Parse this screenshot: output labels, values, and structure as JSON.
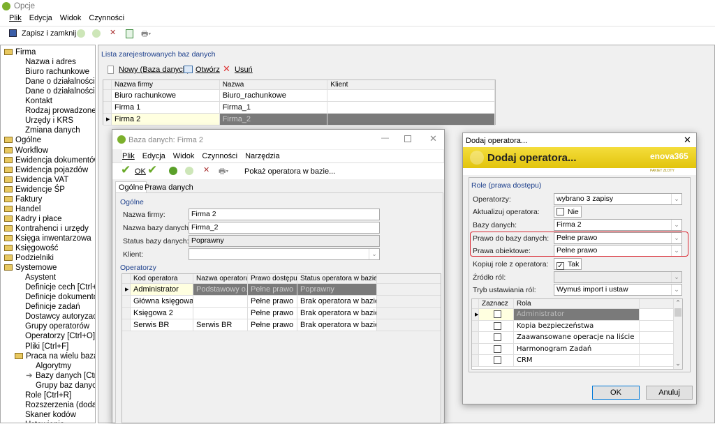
{
  "app": {
    "title": "Opcje",
    "menu": [
      "Plik",
      "Edycja",
      "Widok",
      "Czynności"
    ],
    "toolbar": {
      "save_close": "Zapisz i zamknij"
    }
  },
  "tree": {
    "items": [
      {
        "label": "Firma",
        "level": 0,
        "folder": true
      },
      {
        "label": "Nazwa i adres",
        "level": 2
      },
      {
        "label": "Biuro rachunkowe",
        "level": 2
      },
      {
        "label": "Dane o działalności",
        "level": 2
      },
      {
        "label": "Dane o działalności",
        "level": 2
      },
      {
        "label": "Kontakt",
        "level": 2
      },
      {
        "label": "Rodzaj prowadzonej",
        "level": 2
      },
      {
        "label": "Urzędy i KRS",
        "level": 2
      },
      {
        "label": "Zmiana danych",
        "level": 2
      },
      {
        "label": "Ogólne",
        "level": 0,
        "folder": true
      },
      {
        "label": "Workflow",
        "level": 0,
        "folder": true
      },
      {
        "label": "Ewidencja dokumentów",
        "level": 0,
        "folder": true
      },
      {
        "label": "Ewidencja pojazdów",
        "level": 0,
        "folder": true
      },
      {
        "label": "Ewidencja VAT",
        "level": 0,
        "folder": true
      },
      {
        "label": "Ewidencje ŚP",
        "level": 0,
        "folder": true
      },
      {
        "label": "Faktury",
        "level": 0,
        "folder": true
      },
      {
        "label": "Handel",
        "level": 0,
        "folder": true
      },
      {
        "label": "Kadry i płace",
        "level": 0,
        "folder": true
      },
      {
        "label": "Kontrahenci i urzędy",
        "level": 0,
        "folder": true
      },
      {
        "label": "Księga inwentarzowa",
        "level": 0,
        "folder": true
      },
      {
        "label": "Księgowość",
        "level": 0,
        "folder": true
      },
      {
        "label": "Podzielniki",
        "level": 0,
        "folder": true
      },
      {
        "label": "Systemowe",
        "level": 0,
        "folder": true
      },
      {
        "label": "Asystent",
        "level": 2
      },
      {
        "label": "Definicje cech [Ctrl+H",
        "level": 2
      },
      {
        "label": "Definicje dokumentów",
        "level": 2
      },
      {
        "label": "Definicje zadań",
        "level": 2
      },
      {
        "label": "Dostawcy autoryzacji",
        "level": 2
      },
      {
        "label": "Grupy operatorów",
        "level": 2
      },
      {
        "label": "Operatorzy [Ctrl+O]",
        "level": 2
      },
      {
        "label": "Pliki [Ctrl+F]",
        "level": 2
      },
      {
        "label": "Praca na wielu bazach",
        "level": 1,
        "folder": true
      },
      {
        "label": "Algorytmy",
        "level": 3
      },
      {
        "label": "Bazy danych [Ctrl+",
        "level": 3,
        "current": true
      },
      {
        "label": "Grupy baz danych",
        "level": 3
      },
      {
        "label": "Role [Ctrl+R]",
        "level": 2
      },
      {
        "label": "Rozszerzenia (dodat",
        "level": 2
      },
      {
        "label": "Skaner kodów",
        "level": 2
      },
      {
        "label": "Ustawienia",
        "level": 2
      }
    ]
  },
  "main": {
    "group_title": "Lista zarejestrowanych baz danych",
    "toolbar": {
      "new": "Nowy (Baza danych)",
      "open": "Otwórz",
      "delete": "Usuń"
    },
    "columns": [
      "Nazwa firmy",
      "Nazwa",
      "Klient"
    ],
    "rows": [
      [
        "Biuro rachunkowe",
        "Biuro_rachunkowe",
        ""
      ],
      [
        "Firma 1",
        "Firma_1",
        ""
      ],
      [
        "Firma 2",
        "Firma_2",
        ""
      ]
    ]
  },
  "db_dialog": {
    "title": "Baza danych: Firma 2",
    "menu": [
      "Plik",
      "Edycja",
      "Widok",
      "Czynności",
      "Narzędzia"
    ],
    "toolbar": {
      "ok": "OK",
      "show_operator": "Pokaż operatora w bazie..."
    },
    "tabs": [
      "Ogólne",
      "Prawa danych"
    ],
    "general_group": "Ogólne",
    "fields": [
      {
        "label": "Nazwa firmy:",
        "value": "Firma 2"
      },
      {
        "label": "Nazwa bazy danych:",
        "value": "Firma_2"
      },
      {
        "label": "Status bazy danych:",
        "value": "Poprawny"
      },
      {
        "label": "Klient:",
        "value": ""
      }
    ],
    "operators_group": "Operatorzy",
    "columns": [
      "Kod operatora",
      "Nazwa operatora",
      "Prawo dostępu",
      "Status operatora w bazie"
    ],
    "rows": [
      [
        "Administrator",
        "Podstawowy o...",
        "Pełne prawo",
        "Poprawny"
      ],
      [
        "Główna księgowa",
        "",
        "Pełne prawo",
        "Brak operatora w bazie"
      ],
      [
        "Księgowa 2",
        "",
        "Pełne prawo",
        "Brak operatora w bazie"
      ],
      [
        "Serwis BR",
        "Serwis BR",
        "Pełne prawo",
        "Brak operatora w bazie"
      ]
    ]
  },
  "add_dialog": {
    "title": "Dodaj operatora...",
    "banner": "Dodaj operatora...",
    "logo": "enova365",
    "package": "PAKIET ZŁOTY",
    "group": "Role (prawa dostępu)",
    "fields": [
      {
        "label": "Operatorzy:",
        "value": "wybrano 3 zapisy"
      },
      {
        "label": "Aktualizuj operatora:",
        "value": "Nie",
        "checked": false
      },
      {
        "label": "Bazy danych:",
        "value": "Firma 2"
      },
      {
        "label": "Prawo do bazy danych:",
        "value": "Pełne prawo"
      },
      {
        "label": "Prawa obiektowe:",
        "value": "Pełne prawo"
      },
      {
        "label": "Kopiuj role z operatora:",
        "value": "Tak",
        "checked": true
      },
      {
        "label": "Źródło ról:",
        "value": ""
      },
      {
        "label": "Tryb ustawiania ról:",
        "value": "Wymuś import i ustaw"
      }
    ],
    "columns": [
      "Zaznacz",
      "Rola"
    ],
    "roles": [
      "Administrator",
      "Kopia bezpieczeństwa",
      "Zaawansowane operacje na liście",
      "Harmonogram Zadań",
      "CRM"
    ],
    "ok": "OK",
    "cancel": "Anuluj",
    "highlight_color": "#d9252f"
  }
}
